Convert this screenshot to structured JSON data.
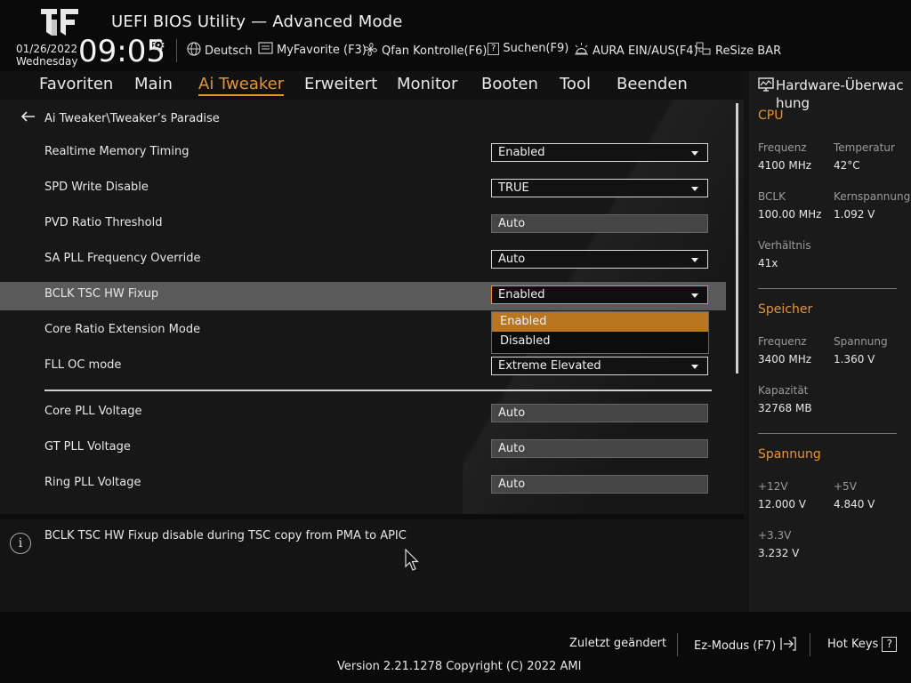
{
  "header": {
    "title": "UEFI BIOS Utility — Advanced Mode",
    "date": "01/26/2022",
    "weekday": "Wednesday",
    "time": "09:05",
    "tools": [
      {
        "icon": "globe-icon",
        "label": "Deutsch"
      },
      {
        "icon": "favorite-icon",
        "label": "MyFavorite (F3)"
      },
      {
        "icon": "fan-icon",
        "label": "Qfan Kontrolle(F6)"
      },
      {
        "icon": "search-help-icon",
        "label": "Suchen(F9)"
      },
      {
        "icon": "aura-icon",
        "label": "AURA EIN/AUS(F4)"
      },
      {
        "icon": "resize-bar-icon",
        "label": "ReSize BAR"
      }
    ]
  },
  "nav": {
    "items": [
      "Favoriten",
      "Main",
      "Ai Tweaker",
      "Erweitert",
      "Monitor",
      "Booten",
      "Tool",
      "Beenden"
    ],
    "active": "Ai Tweaker"
  },
  "breadcrumb": "Ai Tweaker\\Tweaker’s Paradise",
  "settings": [
    {
      "label": "Realtime Memory Timing",
      "value": "Enabled",
      "type": "select"
    },
    {
      "label": "SPD Write Disable",
      "value": "TRUE",
      "type": "select"
    },
    {
      "label": "PVD Ratio Threshold",
      "value": "Auto",
      "type": "readonly"
    },
    {
      "label": "SA PLL Frequency Override",
      "value": "Auto",
      "type": "select"
    },
    {
      "label": "BCLK TSC HW Fixup",
      "value": "Enabled",
      "type": "select"
    },
    {
      "label": "Core Ratio Extension Mode",
      "value": "",
      "type": "none"
    },
    {
      "label": "FLL OC mode",
      "value": "Extreme Elevated",
      "type": "select"
    },
    {
      "label": "Core PLL Voltage",
      "value": "Auto",
      "type": "readonly"
    },
    {
      "label": "GT PLL Voltage",
      "value": "Auto",
      "type": "readonly"
    },
    {
      "label": "Ring PLL Voltage",
      "value": "Auto",
      "type": "readonly"
    }
  ],
  "dropdown": {
    "options": [
      "Enabled",
      "Disabled"
    ],
    "selected": "Enabled"
  },
  "help_text": "BCLK TSC HW Fixup disable during TSC copy from PMA to APIC",
  "hw_monitor": {
    "title": "Hardware-Überwac hung",
    "cpu": {
      "title": "CPU",
      "freq_label": "Frequenz",
      "freq": "4100 MHz",
      "temp_label": "Temperatur",
      "temp": "42°C",
      "bclk_label": "BCLK",
      "bclk": "100.00 MHz",
      "vcore_label": "Kernspannung",
      "vcore": "1.092 V",
      "ratio_label": "Verhältnis",
      "ratio": "41x"
    },
    "memory": {
      "title": "Speicher",
      "freq_label": "Frequenz",
      "freq": "3400 MHz",
      "volt_label": "Spannung",
      "volt": "1.360 V",
      "cap_label": "Kapazität",
      "cap": "32768 MB"
    },
    "voltage": {
      "title": "Spannung",
      "v12_label": "+12V",
      "v12": "12.000 V",
      "v5_label": "+5V",
      "v5": "4.840 V",
      "v33_label": "+3.3V",
      "v33": "3.232 V"
    }
  },
  "footer": {
    "last_changed": "Zuletzt geändert",
    "ez_mode": "Ez-Modus (F7)",
    "hot_keys": "Hot Keys",
    "hot_keys_key": "?",
    "version": "Version 2.21.1278 Copyright (C) 2022 AMI"
  }
}
